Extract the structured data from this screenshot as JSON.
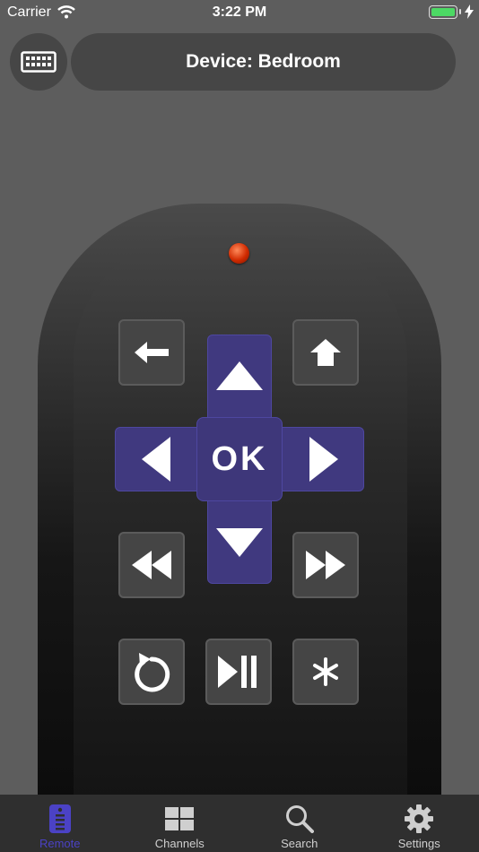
{
  "status_bar": {
    "carrier": "Carrier",
    "time": "3:22 PM",
    "battery_level": 1.0
  },
  "header": {
    "device_label": "Device: Bedroom",
    "keyboard_icon": "keyboard-icon"
  },
  "remote": {
    "dpad_center_label": "OK",
    "accent_color": "#40397f",
    "buttons": [
      "back",
      "home",
      "up",
      "left",
      "ok",
      "right",
      "down",
      "rewind",
      "fast-forward",
      "replay",
      "play-pause",
      "options"
    ]
  },
  "tab_bar": {
    "active": "Remote",
    "active_color": "#4b42c5",
    "tabs": [
      {
        "label": "Remote",
        "icon": "remote-icon"
      },
      {
        "label": "Channels",
        "icon": "grid-icon"
      },
      {
        "label": "Search",
        "icon": "search-icon"
      },
      {
        "label": "Settings",
        "icon": "gear-icon"
      }
    ]
  }
}
